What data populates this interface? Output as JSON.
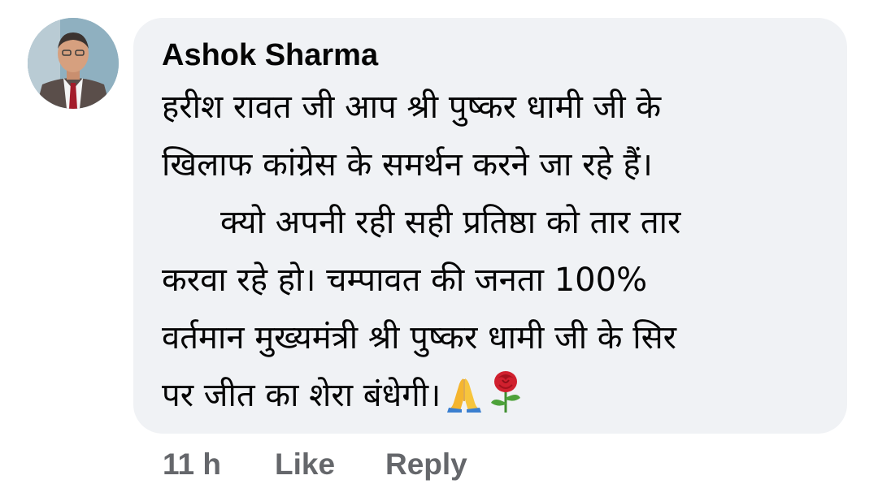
{
  "comment": {
    "author": "Ashok Sharma",
    "lines": [
      "हरीश रावत जी आप श्री पुष्कर धामी जी के",
      "खिलाफ कांग्रेस के समर्थन करने जा रहे हैं।",
      "क्यो अपनी रही सही प्रतिष्ठा को तार तार",
      "करवा रहे हो। चम्पावत की जनता 100%",
      "वर्तमान मुख्यमंत्री श्री पुष्कर धामी जी के सिर",
      "पर जीत का शेरा  बंधेगी।"
    ],
    "emojis": [
      "folded-hands-icon",
      "rose-icon"
    ],
    "timestamp": "11 h",
    "like_label": "Like",
    "reply_label": "Reply"
  },
  "colors": {
    "bubble_bg": "#f0f2f5",
    "text": "#050505",
    "meta_text": "#65676b"
  }
}
